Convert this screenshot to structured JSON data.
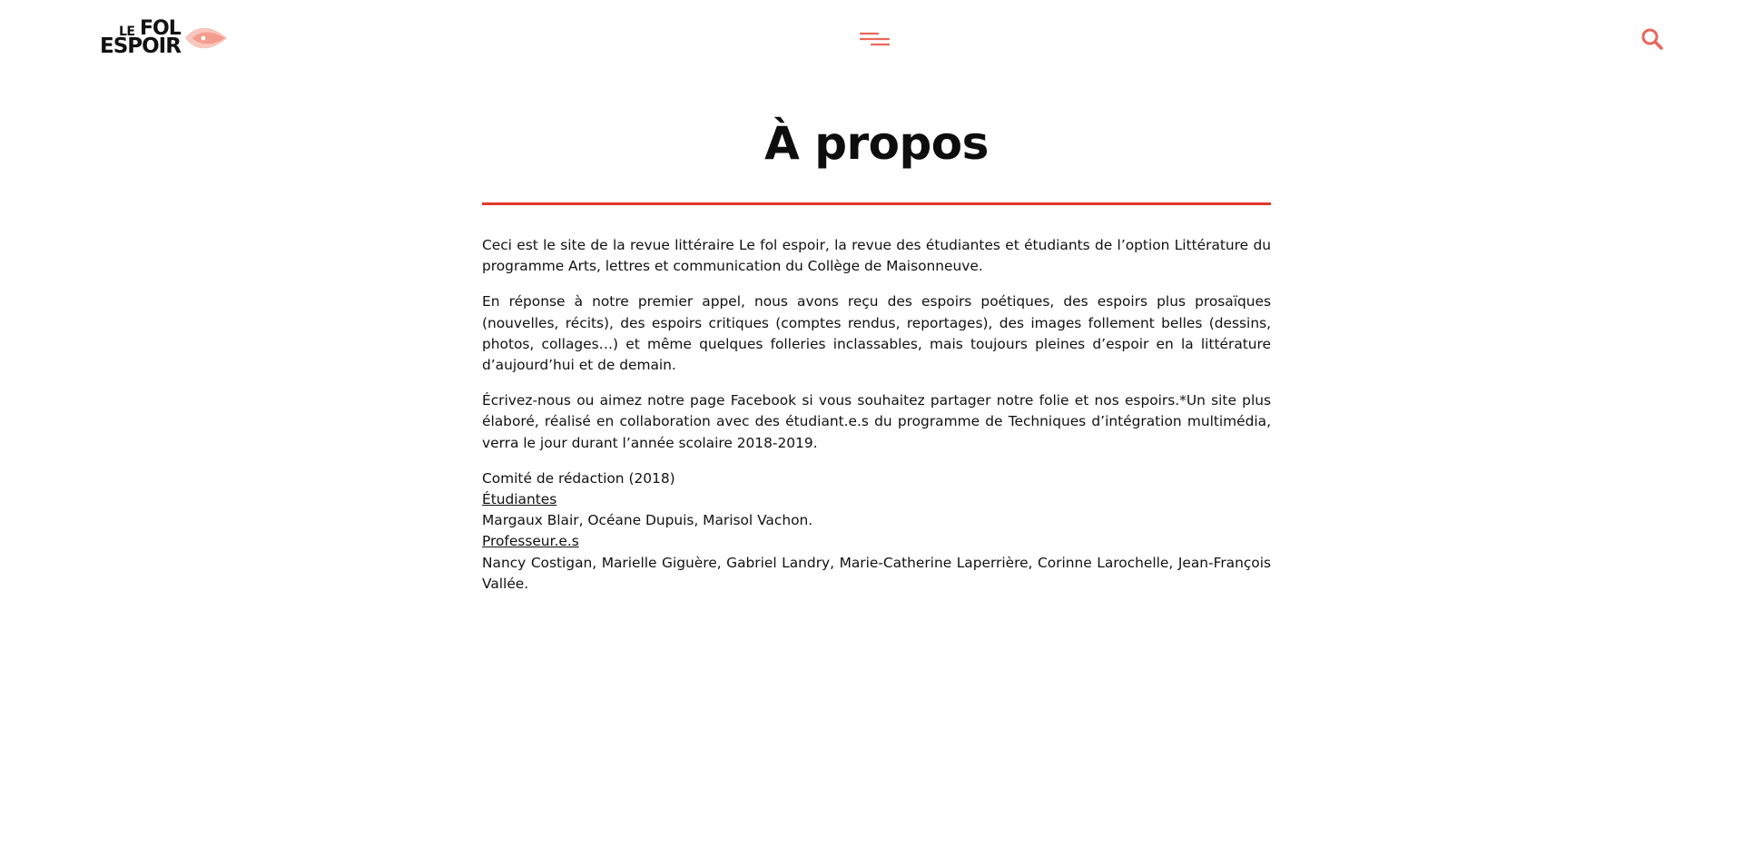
{
  "header": {
    "logo": {
      "line1_prefix": "LE",
      "line1_word": "FOL",
      "line2_word": "ESPOIR",
      "accent_color": "#f28b7a"
    },
    "menu_icon": "hamburger-menu-icon",
    "search_icon": "search-icon",
    "icon_color": "#e8685a"
  },
  "main": {
    "title": "À propos",
    "rule_color": "#e03a2b",
    "paragraphs": [
      "Ceci est le site de la revue littéraire Le fol espoir, la revue des étudiantes et étudiants de l’option Littérature du programme Arts, lettres et communication du Collège de Maisonneuve.",
      "En réponse à notre premier appel, nous avons reçu des espoirs poétiques, des espoirs plus prosaïques (nouvelles, récits), des espoirs critiques (comptes rendus, reportages), des images follement belles (dessins, photos, collages…) et même quelques folleries inclassables, mais toujours pleines d’espoir en la littérature d’aujourd’hui et de demain.",
      "Écrivez-nous ou aimez notre page Facebook si vous souhaitez partager notre folie et nos espoirs.*Un site plus élaboré, réalisé en collaboration avec des étudiant.e.s du programme de Techniques d’intégration multimédia, verra le jour durant l’année scolaire 2018-2019."
    ],
    "committee": {
      "heading": "Comité de rédaction (2018)",
      "students_label": "Étudiantes",
      "students": "Margaux Blair, Océane Dupuis, Marisol Vachon.",
      "teachers_label": "Professeur.e.s",
      "teachers": "Nancy Costigan, Marielle Giguère, Gabriel Landry, Marie-Catherine Laperrière, Corinne Larochelle, Jean-François Vallée."
    }
  }
}
